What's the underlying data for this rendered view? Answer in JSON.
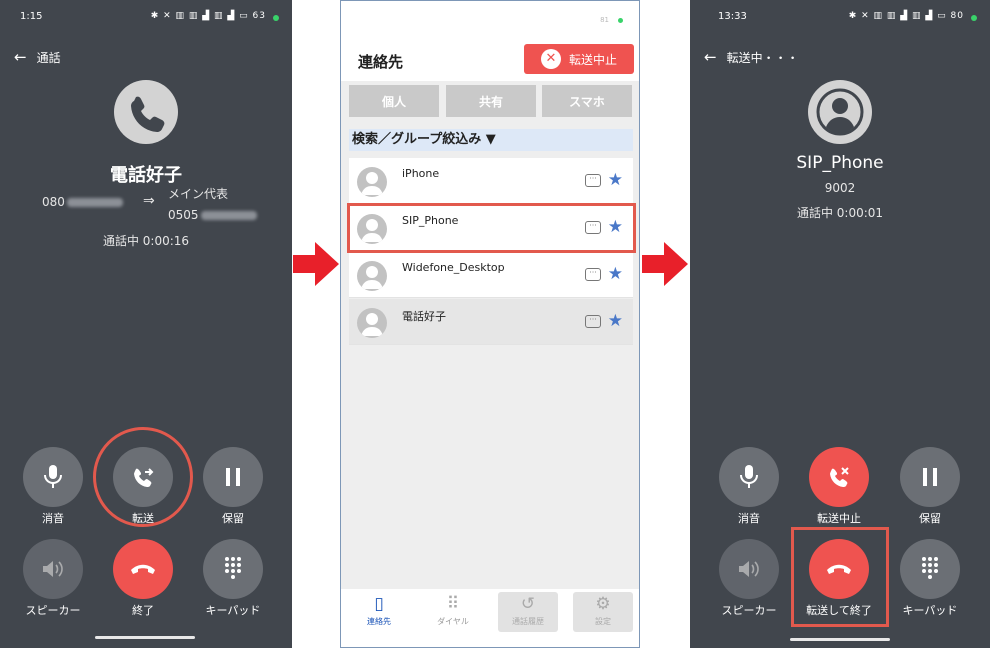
{
  "phone1": {
    "status_time": "1:15",
    "status_icons": "✱ ✕ ▥ ▥ ▟ ▥ ▟ ▭",
    "battery": "63",
    "back_label": "通話",
    "callee_name": "電話好子",
    "caller_number_prefix": "080",
    "arrow": "⇒",
    "line_name": "メイン代表",
    "line_number_prefix": "0505",
    "call_status": "通話中 0:00:16",
    "buttons": {
      "mute": "消音",
      "transfer": "転送",
      "hold": "保留",
      "speaker": "スピーカー",
      "end": "終了",
      "keypad": "キーパッド"
    }
  },
  "phone2": {
    "status_small": "81",
    "title": "連絡先",
    "stop_transfer": "転送中止",
    "tabs": [
      "個人",
      "共有",
      "スマホ"
    ],
    "search_label": "検索／グループ絞込み ▼",
    "contacts": [
      "iPhone",
      "SIP_Phone",
      "Widefone_Desktop",
      "電話好子"
    ],
    "nav": {
      "contacts": "連絡先",
      "dial": "ダイヤル",
      "history": "通話履歴",
      "settings": "設定"
    }
  },
  "phone3": {
    "status_time": "13:33",
    "status_icons": "✱ ✕ ▥ ▥ ▟ ▥ ▟ ▭",
    "battery": "80",
    "back_label": "転送中・・・",
    "callee_name": "SIP_Phone",
    "extension": "9002",
    "call_status": "通話中 0:00:01",
    "buttons": {
      "mute": "消音",
      "cancel_transfer": "転送中止",
      "hold": "保留",
      "speaker": "スピーカー",
      "transfer_end": "転送して終了",
      "keypad": "キーパッド"
    }
  },
  "colors": {
    "phone_bg": "#41464d",
    "button_gray": "#6b6f75",
    "end_red": "#ef5350",
    "highlight_red": "#e2594d",
    "arrow_red": "#e8202a",
    "star_blue": "#4a78c8",
    "nav_active_blue": "#1e56b8"
  }
}
